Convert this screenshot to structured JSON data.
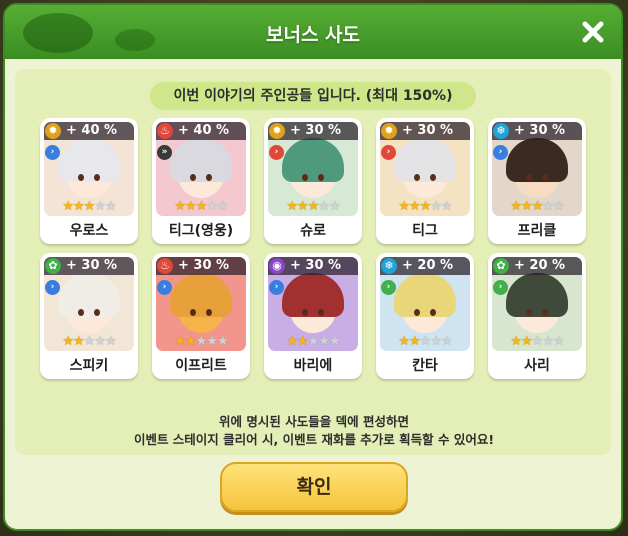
{
  "dialog": {
    "title": "보너스 사도",
    "subtitle": "이번 이야기의 주인공들 입니다. (최대 150%)",
    "note_line1": "위에 명시된 사도들을 덱에 편성하면",
    "note_line2": "이벤트 스테이지 클리어 시, 이벤트 재화를 추가로 획득할 수 있어요!",
    "confirm_label": "확인",
    "close_icon": "close-icon"
  },
  "characters": [
    {
      "name": "우로스",
      "bonus": "+ 40 %",
      "stars": 3,
      "max_stars": 5,
      "element": "light",
      "element_color": "#e0a21a",
      "class_color": "#3a7de0",
      "class_glyph": "›",
      "bg": "#f4e4d6",
      "hair": "#e8e8ec",
      "skin": "#fde9da"
    },
    {
      "name": "티그(영웅)",
      "bonus": "+ 40 %",
      "stars": 3,
      "max_stars": 5,
      "element": "fire",
      "element_color": "#e0483a",
      "class_color": "#3a3a3a",
      "class_glyph": "»",
      "bg": "#f3c9cf",
      "hair": "#d9d9df",
      "skin": "#fde9da"
    },
    {
      "name": "슈로",
      "bonus": "+ 30 %",
      "stars": 3,
      "max_stars": 5,
      "element": "light",
      "element_color": "#e0a21a",
      "class_color": "#e0483a",
      "class_glyph": "›",
      "bg": "#d7e8d4",
      "hair": "#4f9a7c",
      "skin": "#fde9da"
    },
    {
      "name": "티그",
      "bonus": "+ 30 %",
      "stars": 3,
      "max_stars": 5,
      "element": "light",
      "element_color": "#e0a21a",
      "class_color": "#e0483a",
      "class_glyph": "›",
      "bg": "#f3e3c2",
      "hair": "#e3e3e6",
      "skin": "#fde9da"
    },
    {
      "name": "프리클",
      "bonus": "+ 30 %",
      "stars": 3,
      "max_stars": 5,
      "element": "ice",
      "element_color": "#1fa4d8",
      "class_color": "#3a7de0",
      "class_glyph": "›",
      "bg": "#e2d7c8",
      "hair": "#3a2a22",
      "skin": "#f7dcc3"
    },
    {
      "name": "스피키",
      "bonus": "+ 30 %",
      "stars": 2,
      "max_stars": 5,
      "element": "earth",
      "element_color": "#3fb04a",
      "class_color": "#3a7de0",
      "class_glyph": "›",
      "bg": "#f2e6d6",
      "hair": "#f0ece6",
      "skin": "#fde9da"
    },
    {
      "name": "이프리트",
      "bonus": "+ 30 %",
      "stars": 2,
      "max_stars": 5,
      "element": "fire",
      "element_color": "#e0483a",
      "class_color": "#3a7de0",
      "class_glyph": "›",
      "bg": "#f2958d",
      "hair": "#e8a03a",
      "skin": "#f6b34a"
    },
    {
      "name": "바리에",
      "bonus": "+ 30 %",
      "stars": 2,
      "max_stars": 5,
      "element": "dark",
      "element_color": "#8a46c9",
      "class_color": "#3a7de0",
      "class_glyph": "›",
      "bg": "#c9aee6",
      "hair": "#a13030",
      "skin": "#fde9da"
    },
    {
      "name": "칸타",
      "bonus": "+ 20 %",
      "stars": 2,
      "max_stars": 5,
      "element": "ice",
      "element_color": "#1fa4d8",
      "class_color": "#3fb04a",
      "class_glyph": "›",
      "bg": "#cfe4f0",
      "hair": "#e9d57a",
      "skin": "#fde9da"
    },
    {
      "name": "사리",
      "bonus": "+ 20 %",
      "stars": 2,
      "max_stars": 5,
      "element": "earth",
      "element_color": "#3fb04a",
      "class_color": "#3fb04a",
      "class_glyph": "›",
      "bg": "#d8e6cf",
      "hair": "#3f4a3a",
      "skin": "#fde9da"
    }
  ]
}
